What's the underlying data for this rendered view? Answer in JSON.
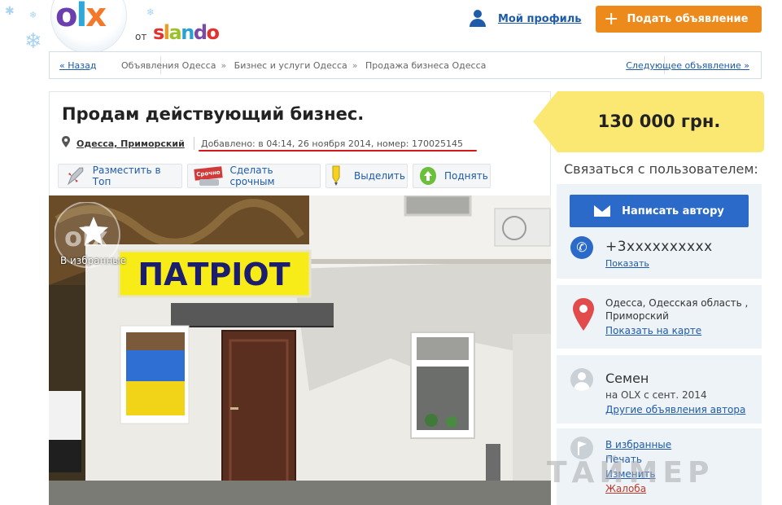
{
  "header": {
    "logo_primary": "OLX",
    "logo_from": "от",
    "logo_secondary": "slando",
    "profile_label": "Мой профиль",
    "post_button_label": "Подать объявление"
  },
  "breadcrumbs": {
    "back_label": "« Назад",
    "items": [
      "Объявления Одесса",
      "Бизнес и услуги Одесса",
      "Продажа бизнеса Одесса"
    ],
    "next_label": "Следующее объявление »"
  },
  "listing": {
    "title": "Продам действующий бизнес.",
    "location": "Одесса, Приморский",
    "added_info": "Добавлено: в 04:14, 26 ноября 2014, номер: 170025145",
    "actions": [
      {
        "label": "Разместить в Топ",
        "icon": "rocket-icon"
      },
      {
        "label": "Сделать срочным",
        "icon": "urgent-stamp-icon",
        "badge": "Срочно"
      },
      {
        "label": "Выделить",
        "icon": "highlighter-icon"
      },
      {
        "label": "Поднять",
        "icon": "lift-up-icon"
      }
    ],
    "photo": {
      "sign_text": "ПАТРІОТ",
      "favorite_overlay_label": "В избранные"
    },
    "price": "130 000 грн."
  },
  "sidebar": {
    "contact_heading": "Связаться с пользователем:",
    "write_button_label": "Написать автору",
    "phone": "+3xxxxxxxxxx",
    "show_phone_label": "Показать",
    "address": "Одесса, Одесская область , Приморский",
    "show_map_label": "Показать на карте",
    "user": {
      "name": "Семен",
      "since": "на OLX с сент. 2014",
      "other_ads_label": "Другие объявления автора"
    },
    "links": {
      "favorites": "В избранные",
      "print": "Печать",
      "edit": "Изменить",
      "report": "Жалоба"
    }
  },
  "watermark": "ТАЙМЕР",
  "colors": {
    "accent_blue": "#2b6ac8",
    "link_blue": "#1e5ba9",
    "orange_button": "#ec8b1c",
    "price_yellow": "#fbe873",
    "highlight_red": "#d21a1a"
  }
}
